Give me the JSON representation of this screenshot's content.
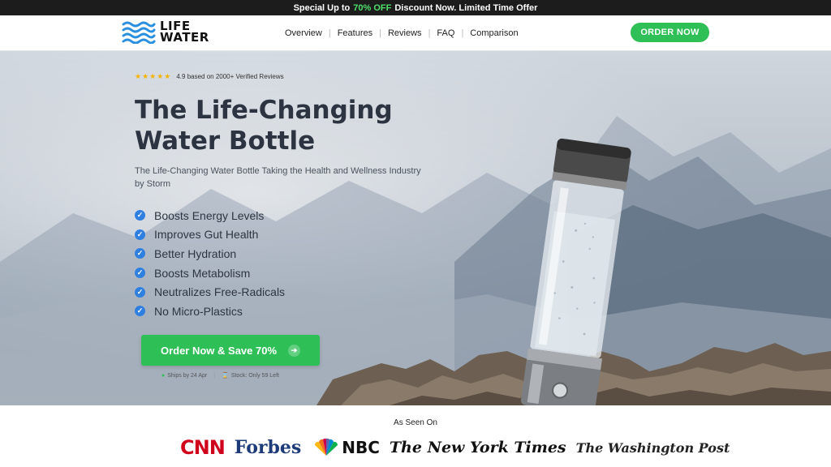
{
  "promo": {
    "before": "Special Up to",
    "highlight": "70% OFF",
    "after": "Discount Now. Limited Time Offer"
  },
  "brand": {
    "line1": "LIFE",
    "line2": "WATER"
  },
  "nav": {
    "items": [
      {
        "label": "Overview"
      },
      {
        "label": "Features"
      },
      {
        "label": "Reviews"
      },
      {
        "label": "FAQ"
      },
      {
        "label": "Comparison"
      }
    ],
    "order_label": "ORDER NOW"
  },
  "hero": {
    "rating_stars": "★★★★★",
    "rating_text": "4.9 based on 2000+ Verified Reviews",
    "headline_line1": "The Life-Changing",
    "headline_line2": "Water Bottle",
    "subline": "The Life-Changing Water Bottle Taking the Health and Wellness Industry by Storm",
    "benefits": [
      "Boosts Energy Levels",
      "Improves Gut Health",
      "Better Hydration",
      "Boosts Metabolism",
      "Neutralizes Free-Radicals",
      "No Micro-Plastics"
    ],
    "cta_label": "Order Now & Save 70%",
    "ships_text": "Ships by 24 Apr",
    "stock_text": "Stock: Only 59 Left"
  },
  "as_seen_on": {
    "title": "As Seen On",
    "logos": [
      "CNN",
      "Forbes",
      "NBC",
      "The New York Times",
      "The Washington Post"
    ]
  },
  "colors": {
    "accent_green": "#2fbf57",
    "check_blue": "#2f7fe0",
    "promo_bg": "#1c1c1c",
    "headline": "#2b3440"
  }
}
